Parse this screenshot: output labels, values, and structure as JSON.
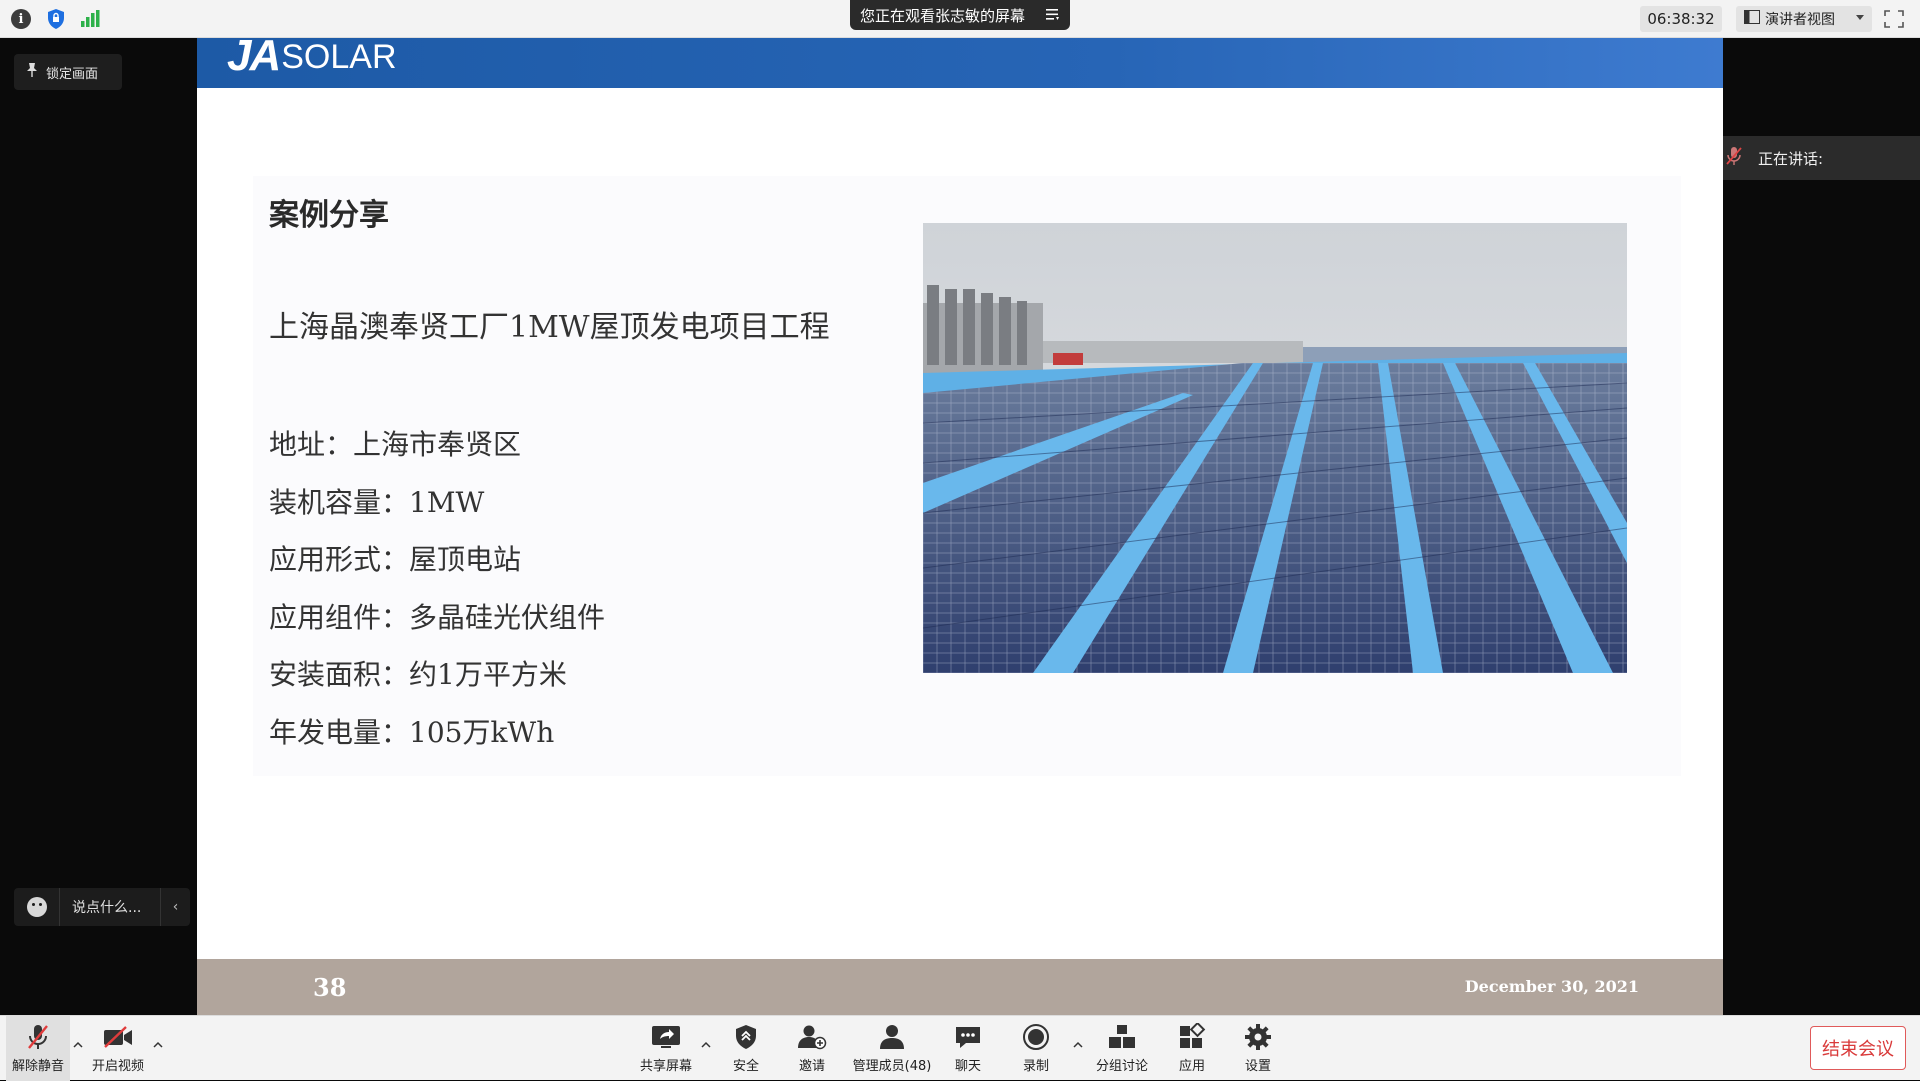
{
  "top_bar": {
    "viewing_label": "您正在观看张志敏的屏幕",
    "time": "06:38:32",
    "presenter_view_label": "演讲者视图"
  },
  "left_panel": {
    "lock_screen_label": "锁定画面",
    "chat_placeholder": "说点什么..."
  },
  "speaking_panel": {
    "label": "正在讲话:"
  },
  "slide": {
    "logo_mark": "JA",
    "logo_word": "SOLAR",
    "title": "案例分享",
    "project_name": "上海晶澳奉贤工厂1MW屋顶发电项目工程",
    "details": [
      "地址：上海市奉贤区",
      "装机容量：1MW",
      "应用形式：屋顶电站",
      "应用组件：多晶硅光伏组件",
      "安装面积：约1万平方米",
      "年发电量：105万kWh"
    ],
    "page_number": "38",
    "date": "December 30, 2021"
  },
  "toolbar": {
    "unmute_label": "解除静音",
    "start_video_label": "开启视频",
    "share_screen_label": "共享屏幕",
    "security_label": "安全",
    "invite_label": "邀请",
    "participants_label": "管理成员(48)",
    "chat_label": "聊天",
    "record_label": "录制",
    "breakout_label": "分组讨论",
    "apps_label": "应用",
    "settings_label": "设置",
    "end_meeting_label": "结束会议"
  },
  "colors": {
    "slide_header_blue": "#2765b6",
    "slide_footer": "#b1a59c",
    "end_meeting_red": "#d93a3a"
  }
}
